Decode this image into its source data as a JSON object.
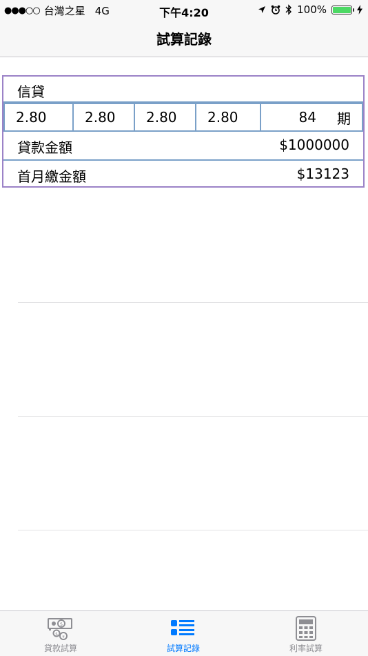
{
  "status_bar": {
    "carrier": "台灣之星",
    "network": "4G",
    "signal": "●●●○○",
    "time": "下午4:20",
    "battery": "100%",
    "battery_color": "#4cd964"
  },
  "nav": {
    "title": "試算記錄"
  },
  "record": {
    "loan_type": "信貸",
    "rates": [
      "2.80",
      "2.80",
      "2.80",
      "2.80"
    ],
    "term_value": "84",
    "term_unit": "期",
    "amount_label": "貸款金額",
    "amount_value": "$1000000",
    "payment_label": "首月繳金額",
    "payment_value": "$13123"
  },
  "tabs": [
    {
      "label": "貸款試算",
      "icon": "money-icon",
      "active": false
    },
    {
      "label": "試算記錄",
      "icon": "list-icon",
      "active": true
    },
    {
      "label": "利率試算",
      "icon": "calculator-icon",
      "active": false
    }
  ],
  "colors": {
    "accent": "#007aff",
    "inactive": "#8e8e93",
    "card_border": "#9b82c7",
    "cell_border": "#7aa0c8"
  }
}
